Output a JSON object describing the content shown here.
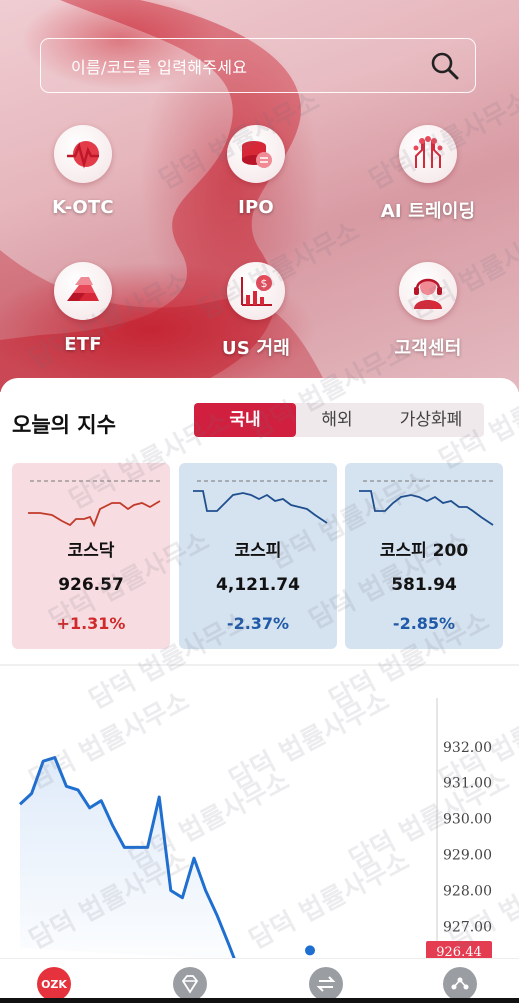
{
  "search": {
    "placeholder": "이름/코드를 입력해주세요"
  },
  "menu": [
    {
      "label": "K-OTC",
      "icon": "pulse-chart-icon"
    },
    {
      "label": "IPO",
      "icon": "coin-exchange-icon"
    },
    {
      "label": "AI 트레이딩",
      "icon": "circuit-icon"
    },
    {
      "label": "ETF",
      "icon": "gold-bars-icon"
    },
    {
      "label": "US 거래",
      "icon": "dollar-chart-icon"
    },
    {
      "label": "고객센터",
      "icon": "headset-agent-icon"
    }
  ],
  "index_section": {
    "title": "오늘의 지수",
    "tabs": [
      {
        "label": "국내",
        "active": true
      },
      {
        "label": "해외",
        "active": false
      },
      {
        "label": "가상화폐",
        "active": false
      }
    ],
    "cards": [
      {
        "name": "코스닥",
        "value": "926.57",
        "change": "+1.31%",
        "direction": "up",
        "color": "#d12a2a"
      },
      {
        "name": "코스피",
        "value": "4,121.74",
        "change": "-2.37%",
        "direction": "down",
        "color": "#1f5aa8"
      },
      {
        "name": "코스피 200",
        "value": "581.94",
        "change": "-2.85%",
        "direction": "down",
        "color": "#1f5aa8"
      }
    ]
  },
  "chart_data": {
    "type": "line",
    "series": [
      {
        "values": [
          930.4,
          930.7,
          931.6,
          931.7,
          930.9,
          930.8,
          930.3,
          930.5,
          929.8,
          929.2,
          929.2,
          929.2,
          930.6,
          928.0,
          927.8,
          928.9,
          928.0,
          927.3,
          926.5
        ]
      }
    ],
    "y_ticks": [
      "932.00",
      "931.00",
      "930.00",
      "929.00",
      "928.00",
      "927.00"
    ],
    "ylim": [
      926.4,
      932.3
    ],
    "current_price_label": "926.44",
    "line_color": "#1f6fd1"
  },
  "nav": [
    {
      "label": "OZK",
      "icon": "ozk-logo-icon"
    },
    {
      "icon": "diamond-icon"
    },
    {
      "icon": "transfer-arrows-icon"
    },
    {
      "icon": "share-nodes-icon"
    }
  ],
  "colors": {
    "accent": "#d1203f",
    "up": "#d12a2a",
    "down": "#1f5aa8"
  },
  "watermark": "담덕 법률사무소"
}
